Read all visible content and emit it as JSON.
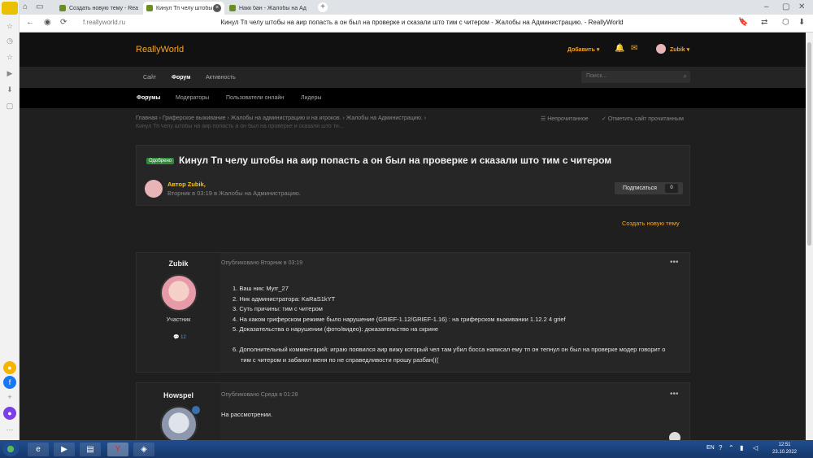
{
  "browser": {
    "tabs": [
      {
        "label": "Создать новую тему - Rea",
        "active": false
      },
      {
        "label": "Кинул Тп челу штобы н",
        "active": true
      },
      {
        "label": "Накк бан - Жалобы на Ад",
        "active": false
      }
    ],
    "url": "f.reallyworld.ru",
    "page_title": "Кинул Тп челу штобы на аир попасть а он был на проверке и сказали што тим с читером - Жалобы на Администрацию. - ReallyWorld"
  },
  "site": {
    "logo": "ReallyWorld",
    "add_label": "Добавить",
    "user": "Zubik",
    "nav_main": [
      "Сайт",
      "Форум",
      "Активность"
    ],
    "search_placeholder": "Поиск...",
    "nav_sub": [
      "Форумы",
      "Модераторы",
      "Пользователи онлайн",
      "Лидеры"
    ]
  },
  "breadcrumb": {
    "items": [
      "Главная",
      "Гриферское выживание",
      "Жалобы на администрацию и на игроков.",
      "Жалобы на Администрацию."
    ],
    "current": "Кинул Тп челу штобы на аир попасть а он был на проверке и сказали што тим с читером",
    "unread": "Непрочитанное",
    "mark_read": "Отметить сайт прочитанным"
  },
  "topic": {
    "badge": "Одобрено",
    "title": "Кинул Тп челу штобы на аир попасть а он был на проверке и сказали што тим с читером",
    "author_line": "Автор Zubik,",
    "meta": "Вторник в 03:19 в Жалобы на Администрацию.",
    "subscribe_label": "Подписаться",
    "subscribe_count": "0",
    "create_topic": "Создать новую тему"
  },
  "posts": [
    {
      "author": "Zubik",
      "role": "Участник",
      "reputation": "12",
      "published": "Опубликовано Вторник в 03:19",
      "lines": [
        "1. Ваш ник: Myrr_27",
        "2. Ник администратора: KaRaS1kYT",
        "3. Суть причины: тим с читером",
        "4. На каком гриферском режиме было нарушение (GRIEF-1.12/GRIEF-1.16) : на гриферском выживании 1.12.2 4 grief",
        "5. Доказательства о нарушении (фото/видео): доказательство на скрине",
        "",
        "6. Дополнительный комментарий: играю появился аир вижу который чел там убил босса написал ему тп он тепнул он был на проверке модер говорит о",
        "тим с читером и забанил меня по не справедливости прошу разбан((("
      ]
    },
    {
      "author": "Howspel",
      "published": "Опубликовано Среда в 01:28",
      "text": "На рассмотрении."
    }
  ],
  "taskbar": {
    "lang": "EN",
    "time": "12:51",
    "date": "23.10.2022"
  },
  "colors": {
    "accent": "#f5a623",
    "approved": "#2e8b3a"
  }
}
